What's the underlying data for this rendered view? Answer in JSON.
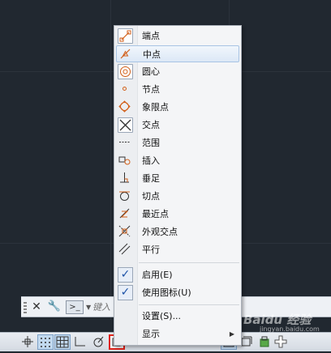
{
  "command_line": {
    "input_placeholder": "键入"
  },
  "osnap_menu": {
    "items": [
      {
        "label": "端点",
        "icon": "endpoint-icon"
      },
      {
        "label": "中点",
        "icon": "midpoint-icon",
        "highlighted": true
      },
      {
        "label": "圆心",
        "icon": "center-icon"
      },
      {
        "label": "节点",
        "icon": "node-icon"
      },
      {
        "label": "象限点",
        "icon": "quadrant-icon"
      },
      {
        "label": "交点",
        "icon": "intersection-icon"
      },
      {
        "label": "范围",
        "icon": "extension-icon"
      },
      {
        "label": "插入",
        "icon": "insertion-icon"
      },
      {
        "label": "垂足",
        "icon": "perpendicular-icon"
      },
      {
        "label": "切点",
        "icon": "tangent-icon"
      },
      {
        "label": "最近点",
        "icon": "nearest-icon"
      },
      {
        "label": "外观交点",
        "icon": "apparent-intersection-icon"
      },
      {
        "label": "平行",
        "icon": "parallel-icon"
      }
    ],
    "toggles": [
      {
        "label": "启用(E)",
        "checked": true
      },
      {
        "label": "使用图标(U)",
        "checked": true
      }
    ],
    "settings_label": "设置(S)...",
    "display_label": "显示"
  },
  "watermark": {
    "text": "Baidu 经验",
    "sub": "jingyan.baidu.com"
  },
  "colors": {
    "canvas": "#212830",
    "menu_bg": "#f4f5f7",
    "highlight_border": "#a8c4e4",
    "selected_button_border": "#e0241b",
    "icon_accent": "#d2601a"
  }
}
